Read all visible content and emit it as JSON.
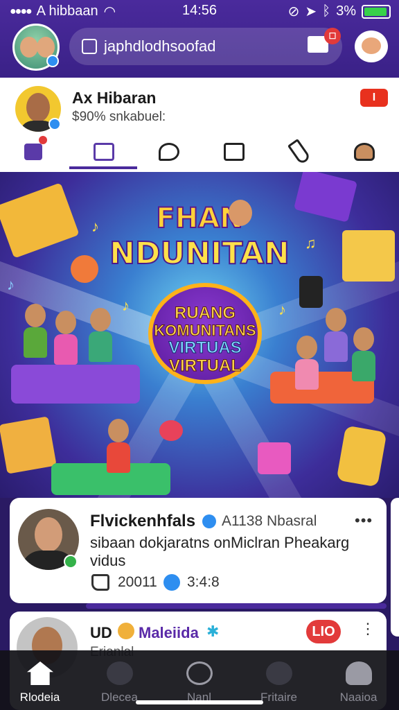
{
  "status_bar": {
    "carrier": "A hibbaan",
    "time": "14:56",
    "battery_percent": "3%",
    "battery_level": 0.95,
    "icons": [
      "signal-icon",
      "wifi-icon",
      "alarm-icon",
      "location-icon",
      "bluetooth-icon",
      "battery-icon"
    ]
  },
  "header": {
    "search_text": "japhdlodhsoofad",
    "cart_badge": "☐",
    "colors": {
      "bar": "#4a2a9c",
      "badge": "#e23a3a"
    }
  },
  "profile": {
    "name": "Ax Hibaran",
    "subtitle": "$90% snkabuel:",
    "tag": "I",
    "tabs": [
      "home-icon",
      "gallery-icon",
      "chat-icon",
      "mail-icon",
      "edit-icon",
      "profile-icon"
    ],
    "active_tab": 1
  },
  "banner": {
    "title_line1": "FHAN",
    "title_line2": "NDUNITAN",
    "circle_line1": "RUANG",
    "circle_line2": "KOMUNITANS",
    "circle_line3": "VIRTUAS",
    "circle_line4": "VIRTUAL"
  },
  "posts": [
    {
      "author": "Flvickenhfals",
      "meta": "A1138 Nbasral",
      "text": "sibaan dokjaratns onMiclran Pheakarg vidus",
      "likes": "20011",
      "shares": "3:4:8",
      "more": "•••"
    },
    {
      "author_prefix": "UD",
      "author": "Maleiida",
      "subtitle": "Erianlal",
      "badge": "LIO",
      "more": "⋮"
    }
  ],
  "bottom_nav": [
    {
      "label": "Rlodeia",
      "icon": "home-icon",
      "active": true
    },
    {
      "label": "Dlecea",
      "icon": "globe-icon",
      "active": false
    },
    {
      "label": "Nanl",
      "icon": "clock-icon",
      "active": false
    },
    {
      "label": "Fritaire",
      "icon": "explore-icon",
      "active": false
    },
    {
      "label": "Naaioa",
      "icon": "profile-icon",
      "active": false
    }
  ]
}
